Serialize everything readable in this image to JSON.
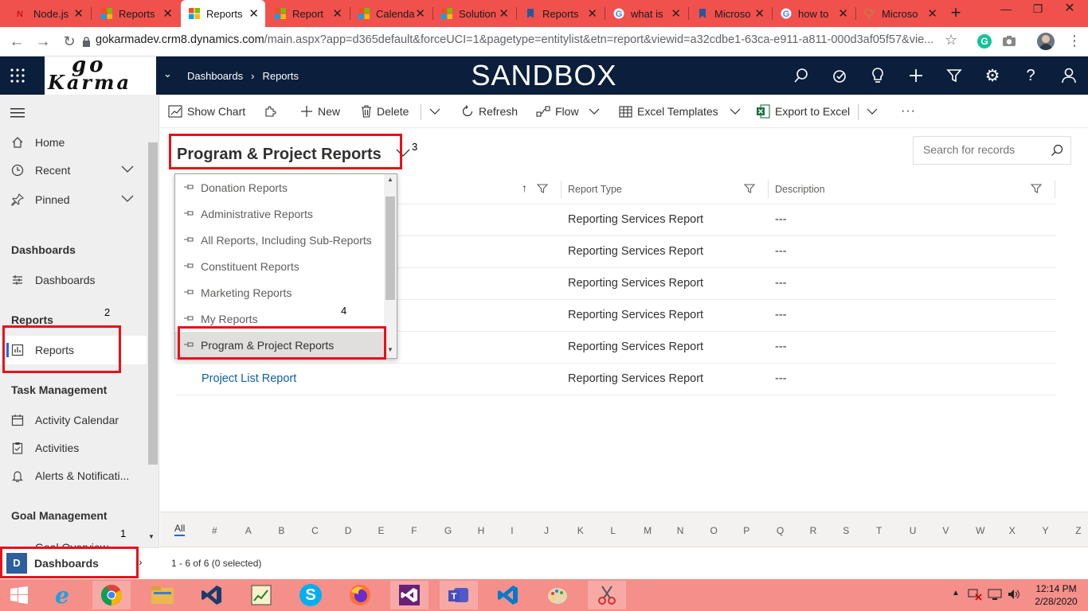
{
  "browser": {
    "tabs": [
      {
        "title": "Node.js",
        "favicon": "node-icon",
        "color": "#e8474c"
      },
      {
        "title": "Reports",
        "favicon": "ms-icon",
        "color": "#f25022"
      },
      {
        "title": "Reports",
        "favicon": "ms-icon",
        "color": "#f25022",
        "active": true
      },
      {
        "title": "Report",
        "favicon": "ms-icon",
        "color": "#f25022"
      },
      {
        "title": "Calenda",
        "favicon": "ms-icon",
        "color": "#f25022"
      },
      {
        "title": "Solution",
        "favicon": "ms-icon",
        "color": "#f25022"
      },
      {
        "title": "Reports",
        "favicon": "bookmark-icon",
        "color": "#2b579a"
      },
      {
        "title": "what is",
        "favicon": "google-icon",
        "color": "#4285f4"
      },
      {
        "title": "Microso",
        "favicon": "bookmark-icon",
        "color": "#2b579a"
      },
      {
        "title": "how to",
        "favicon": "google-icon",
        "color": "#4285f4"
      },
      {
        "title": "Microso",
        "favicon": "spiral-icon",
        "color": "#c47b4b"
      }
    ],
    "new_tab": "+",
    "url_host": "gokarmadev.crm8.dynamics.com",
    "url_path": "/main.aspx?app=d365default&forceUCI=1&pagetype=entitylist&etn=report&viewid=a32cdbe1-63ca-e911-a811-000d3af05f57&vie..."
  },
  "header": {
    "logo_text_top": "go",
    "logo_text_bottom": "Karma",
    "breadcrumb": [
      "Dashboards",
      "Reports"
    ],
    "environment": "SANDBOX"
  },
  "sidebar": {
    "items_top": [
      {
        "label": "Home",
        "icon": "home-icon"
      },
      {
        "label": "Recent",
        "icon": "clock-icon"
      },
      {
        "label": "Pinned",
        "icon": "pin-icon"
      }
    ],
    "sections": [
      {
        "title": "Dashboards",
        "items": [
          {
            "label": "Dashboards",
            "icon": "dashboard-icon"
          }
        ]
      },
      {
        "title": "Reports",
        "items": [
          {
            "label": "Reports",
            "icon": "report-icon"
          }
        ]
      },
      {
        "title": "Task Management",
        "items": [
          {
            "label": "Activity Calendar",
            "icon": "calendar-icon"
          },
          {
            "label": "Activities",
            "icon": "clipboard-icon"
          },
          {
            "label": "Alerts & Notificati...",
            "icon": "bell-icon"
          }
        ]
      },
      {
        "title": "Goal Management",
        "items": [
          {
            "label": "Goal Overview",
            "icon": "goal-icon"
          }
        ]
      }
    ],
    "area_badge": "D",
    "area_label": "Dashboards"
  },
  "annotations": [
    "1",
    "2",
    "3",
    "4"
  ],
  "commands": {
    "show_chart": "Show Chart",
    "new": "New",
    "delete": "Delete",
    "refresh": "Refresh",
    "flow": "Flow",
    "excel_templates": "Excel Templates",
    "export": "Export to Excel",
    "more": "···"
  },
  "view": {
    "title": "Program & Project Reports",
    "search_placeholder": "Search for records",
    "columns": [
      "Report Type",
      "Description"
    ],
    "rows": [
      {
        "name": "",
        "type": "Reporting Services Report",
        "desc": "---"
      },
      {
        "name": "",
        "type": "Reporting Services Report",
        "desc": "---"
      },
      {
        "name": "",
        "type": "Reporting Services Report",
        "desc": "---"
      },
      {
        "name": "",
        "type": "Reporting Services Report",
        "desc": "---"
      },
      {
        "name": "",
        "type": "Reporting Services Report",
        "desc": "---"
      },
      {
        "name": "Project List Report",
        "type": "Reporting Services Report",
        "desc": "---"
      }
    ],
    "dropdown_options": [
      "Donation Reports",
      "Administrative Reports",
      "All Reports, Including Sub-Reports",
      "Constituent Reports",
      "Marketing Reports",
      "My Reports",
      "Program & Project Reports"
    ],
    "selected_option": "Program & Project Reports"
  },
  "alpha": [
    "All",
    "#",
    "A",
    "B",
    "C",
    "D",
    "E",
    "F",
    "G",
    "H",
    "I",
    "J",
    "K",
    "L",
    "M",
    "N",
    "O",
    "P",
    "Q",
    "R",
    "S",
    "T",
    "U",
    "V",
    "W",
    "X",
    "Y",
    "Z"
  ],
  "status_text": "1 - 6 of 6 (0 selected)",
  "taskbar": {
    "time": "12:14 PM",
    "date": "2/28/2020"
  }
}
